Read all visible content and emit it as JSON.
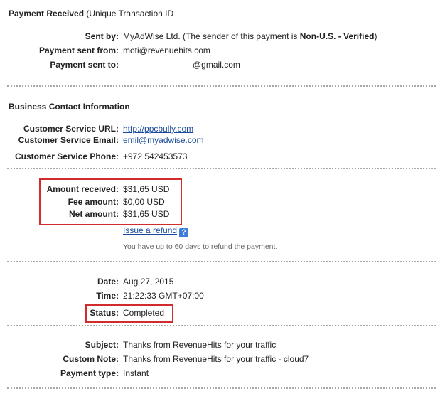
{
  "header": {
    "title_bold": "Payment Received",
    "title_rest": " (Unique Transaction ID"
  },
  "sender": {
    "sent_by_label": "Sent by:",
    "sent_by_value_pre": "MyAdWise Ltd. (The sender of this payment is ",
    "sent_by_status": "Non-U.S. - Verified",
    "sent_by_value_post": ")",
    "sent_from_label": "Payment sent from:",
    "sent_from_value": "moti@revenuehits.com",
    "sent_to_label": "Payment sent to:",
    "sent_to_value": "@gmail.com"
  },
  "contact": {
    "heading": "Business Contact Information",
    "url_label": "Customer Service URL:",
    "url_value": "http://ppcbully.com",
    "email_label": "Customer Service Email:",
    "email_value": "emil@myadwise.com",
    "phone_label": "Customer Service Phone:",
    "phone_value": "+972 542453573"
  },
  "amounts": {
    "received_label": "Amount received:",
    "received_value": "$31,65 USD",
    "fee_label": "Fee amount:",
    "fee_value": "$0,00 USD",
    "net_label": "Net amount:",
    "net_value": "$31,65 USD",
    "refund_link": "Issue a refund",
    "help_glyph": "?",
    "refund_hint": "You have up to 60 days to refund the payment."
  },
  "details": {
    "date_label": "Date:",
    "date_value": "Aug 27, 2015",
    "time_label": "Time:",
    "time_value": "21:22:33 GMT+07:00",
    "status_label": "Status:",
    "status_value": "Completed"
  },
  "notes": {
    "subject_label": "Subject:",
    "subject_value": "Thanks from RevenueHits for your traffic",
    "custom_note_label": "Custom Note:",
    "custom_note_value": "Thanks from RevenueHits for your traffic - cloud7",
    "payment_type_label": "Payment type:",
    "payment_type_value": "Instant"
  },
  "colors": {
    "highlight_box": "#d12b2b",
    "link": "#1a4b9b",
    "separator": "#a8a8a8"
  },
  "icons": {
    "help": "help-icon"
  }
}
